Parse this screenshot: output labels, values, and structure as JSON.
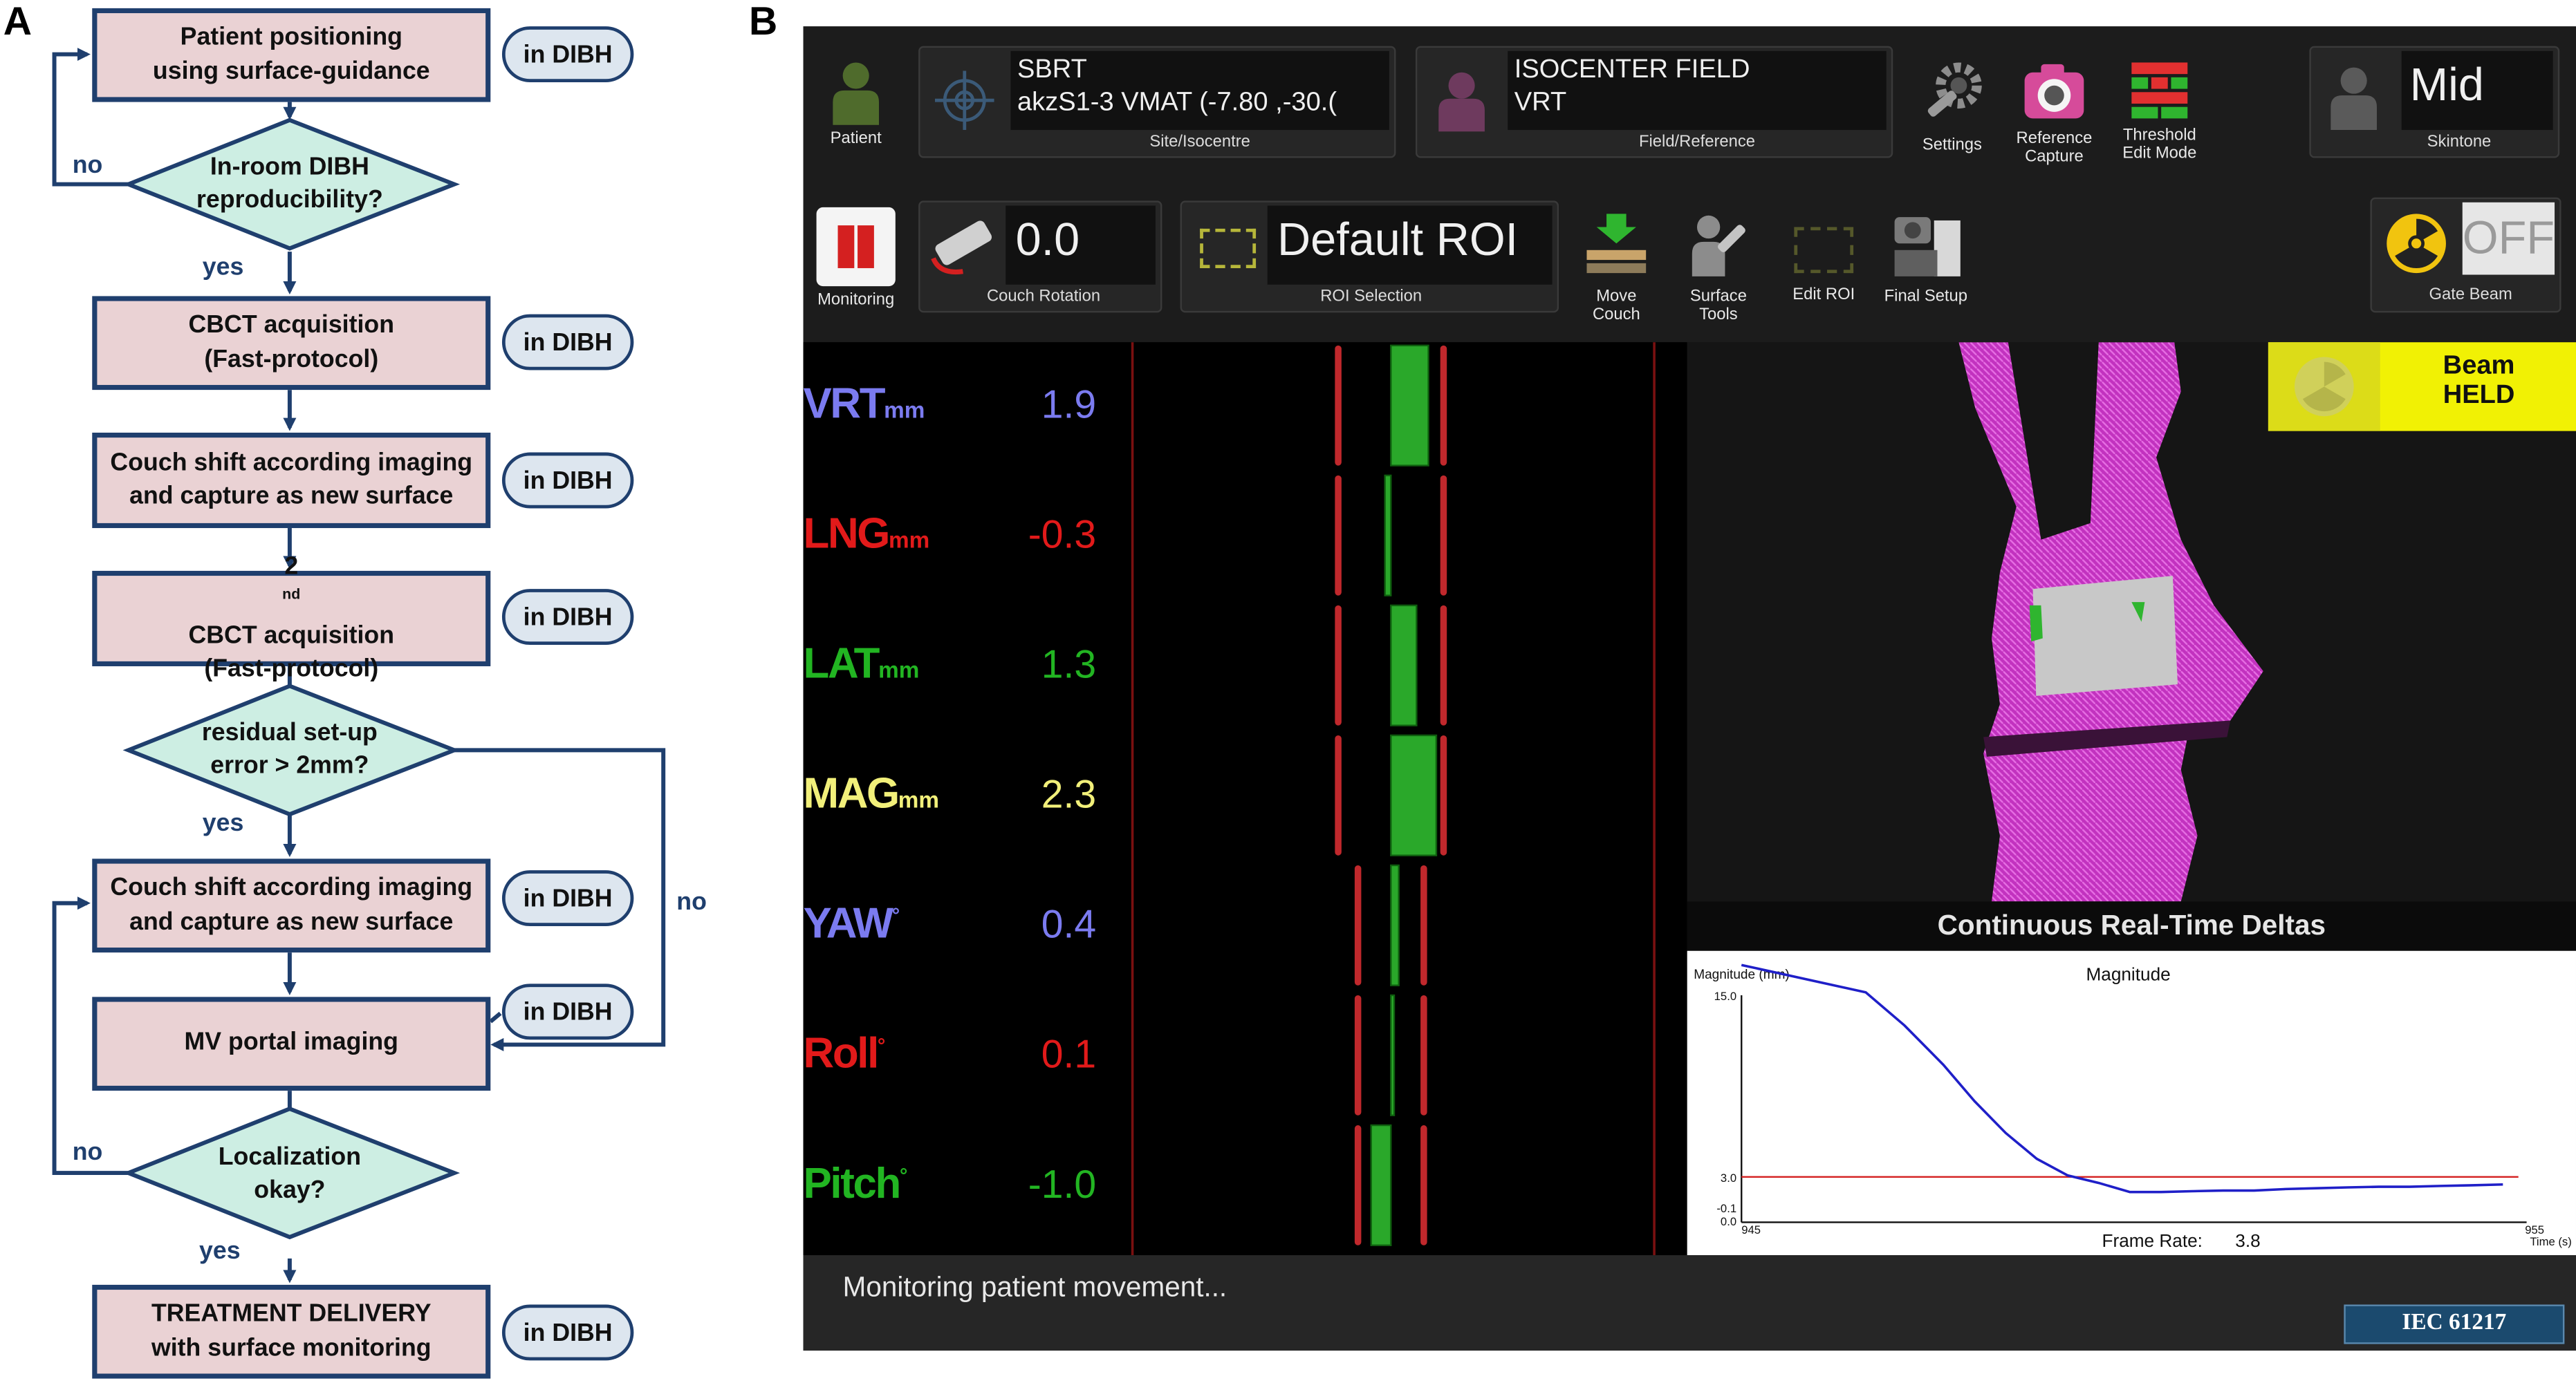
{
  "panel_a": {
    "letter": "A",
    "boxes": [
      {
        "line1": "Patient positioning",
        "line2": "using surface-guidance"
      },
      {
        "line1": "CBCT acquisition",
        "line2": "(Fast-protocol)"
      },
      {
        "line1": "Couch shift according imaging",
        "line2": "and capture as new surface"
      },
      {
        "line1_pre": "2",
        "line1_sup": "nd",
        "line1_post": " CBCT acquisition",
        "line2": "(Fast-protocol)"
      },
      {
        "line1": "Couch shift according imaging",
        "line2": "and capture as new surface"
      },
      {
        "line1": "MV portal imaging",
        "line2": ""
      },
      {
        "line1": "TREATMENT DELIVERY",
        "line2": "with surface monitoring"
      }
    ],
    "decisions": [
      {
        "line1": "In-room DIBH",
        "line2": "reproducibility?"
      },
      {
        "line1": "residual set-up",
        "line2": "error > 2mm?"
      },
      {
        "line1": "Localization",
        "line2": "okay?"
      }
    ],
    "pill_label": "in DIBH",
    "yes": "yes",
    "no": "no"
  },
  "panel_b": {
    "letter": "B",
    "toolbar1": {
      "patient": "Patient",
      "site_line1": "SBRT",
      "site_line2": "akzS1-3 VMAT (-7.80 ,-30.(",
      "site_caption": "Site/Isocentre",
      "field_line1": "ISOCENTER FIELD",
      "field_line2": "VRT",
      "field_caption": "Field/Reference",
      "settings": "Settings",
      "ref_capture_1": "Reference",
      "ref_capture_2": "Capture",
      "threshold_1": "Threshold",
      "threshold_2": "Edit Mode",
      "skintone_value": "Mid",
      "skintone_caption": "Skintone"
    },
    "toolbar2": {
      "monitoring": "Monitoring",
      "couch_rotation_value": "0.0",
      "couch_rotation_caption": "Couch Rotation",
      "roi_value": "Default ROI",
      "roi_caption": "ROI Selection",
      "move_couch_1": "Move",
      "move_couch_2": "Couch",
      "surface_tools_1": "Surface",
      "surface_tools_2": "Tools",
      "edit_roi": "Edit ROI",
      "final_setup": "Final Setup",
      "gate_off": "OFF",
      "gate_caption": "Gate Beam"
    },
    "deltas": [
      {
        "name": "VRT",
        "unit": "mm",
        "value": "1.9",
        "num": 1.9,
        "color": "#7b7bf0"
      },
      {
        "name": "LNG",
        "unit": "mm",
        "value": "-0.3",
        "num": -0.3,
        "color": "#e21a1a"
      },
      {
        "name": "LAT",
        "unit": "mm",
        "value": "1.3",
        "num": 1.3,
        "color": "#22b522"
      },
      {
        "name": "MAG",
        "unit": "mm",
        "value": "2.3",
        "num": 2.3,
        "color": "#f2f07a"
      },
      {
        "name": "YAW",
        "unit": "°",
        "value": "0.4",
        "num": 0.4,
        "color": "#7b7bf0"
      },
      {
        "name": "Roll",
        "unit": "°",
        "value": "0.1",
        "num": 0.1,
        "color": "#e21a1a"
      },
      {
        "name": "Pitch",
        "unit": "°",
        "value": "-1.0",
        "num": -1.0,
        "color": "#22b522"
      }
    ],
    "beam_status_1": "Beam",
    "beam_status_2": "HELD",
    "realtime_title": "Continuous Real-Time Deltas",
    "chart_data": {
      "type": "line",
      "title": "Magnitude",
      "ylabel": "Magnitude (mm)",
      "xlabel": "Time (s)",
      "xlim": [
        945,
        955
      ],
      "ylim": [
        0.0,
        15.0
      ],
      "x_ticks": [
        "945",
        "955"
      ],
      "y_ticks": [
        "15.0",
        "3.0",
        "-0.1",
        "0.0"
      ],
      "threshold": 3.0,
      "threshold_color": "#d42020",
      "line_color": "#1f1fc8",
      "frame_rate_label": "Frame Rate:",
      "frame_rate_value": "3.8",
      "series": [
        {
          "x": [
            945.0,
            946.6,
            947.1,
            947.6,
            948.0,
            948.4,
            948.8,
            949.2,
            949.6,
            950.0,
            950.4,
            950.8,
            951.2,
            951.6,
            952.0,
            952.4,
            952.8,
            953.2,
            953.6,
            954.0,
            954.4,
            954.8
          ],
          "y": [
            17.0,
            15.2,
            13.0,
            10.4,
            8.0,
            5.9,
            4.2,
            3.1,
            2.6,
            2.0,
            2.0,
            2.05,
            2.1,
            2.1,
            2.2,
            2.25,
            2.3,
            2.35,
            2.35,
            2.4,
            2.45,
            2.5
          ]
        }
      ]
    },
    "status_text": "Monitoring patient movement...",
    "iec_label": "IEC 61217"
  }
}
